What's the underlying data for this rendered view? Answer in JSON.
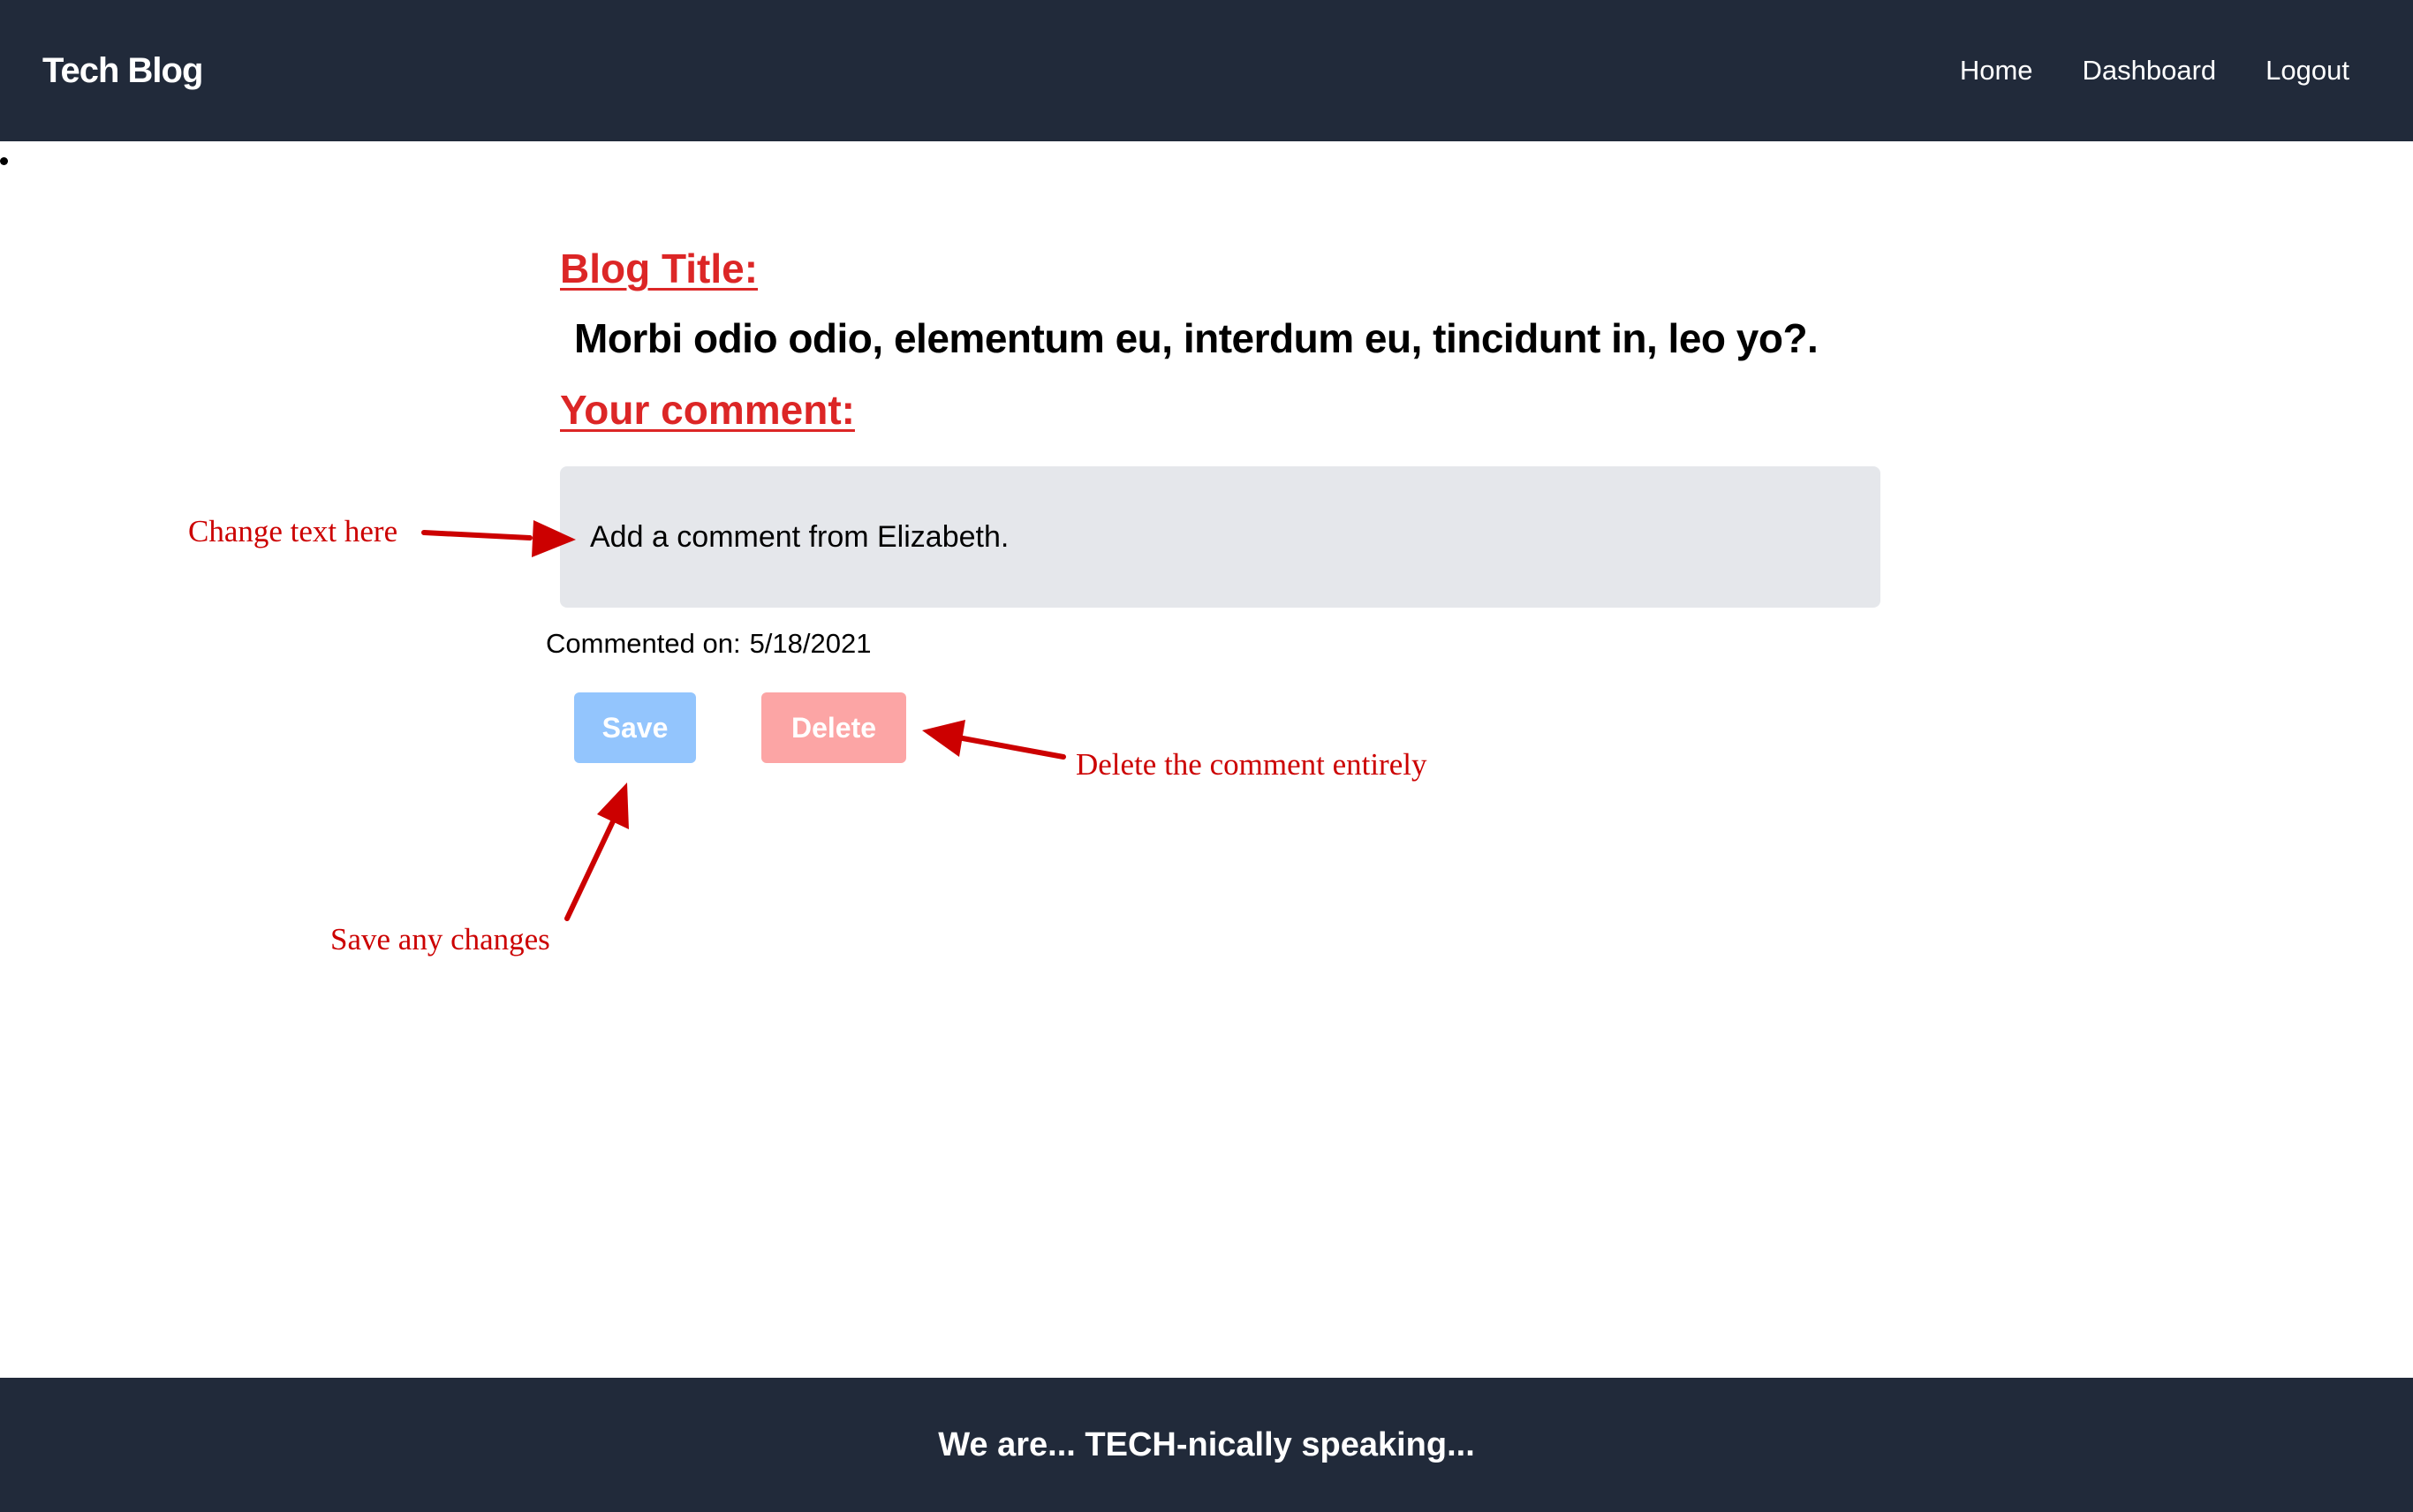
{
  "header": {
    "brand": "Tech Blog",
    "nav": {
      "home": "Home",
      "dashboard": "Dashboard",
      "logout": "Logout"
    }
  },
  "main": {
    "blog_title_label": "Blog Title:",
    "blog_title": "Morbi odio odio, elementum eu, interdum eu, tincidunt in, leo yo?.",
    "comment_label": "Your comment:",
    "comment_value": "Add a comment from Elizabeth.",
    "commented_on_label": "Commented on:",
    "commented_on_date": "5/18/2021",
    "save_label": "Save",
    "delete_label": "Delete"
  },
  "annotations": {
    "change_text": "Change text here",
    "delete_comment": "Delete the comment entirely",
    "save_changes": "Save any changes"
  },
  "footer": {
    "text": "We are... TECH-nically speaking..."
  },
  "colors": {
    "header_bg": "#212a3a",
    "label_red": "#dc2626",
    "annotation_red": "#cc0000",
    "save_button": "#93c5fd",
    "delete_button": "#fca5a5",
    "comment_box": "#e5e7eb"
  }
}
